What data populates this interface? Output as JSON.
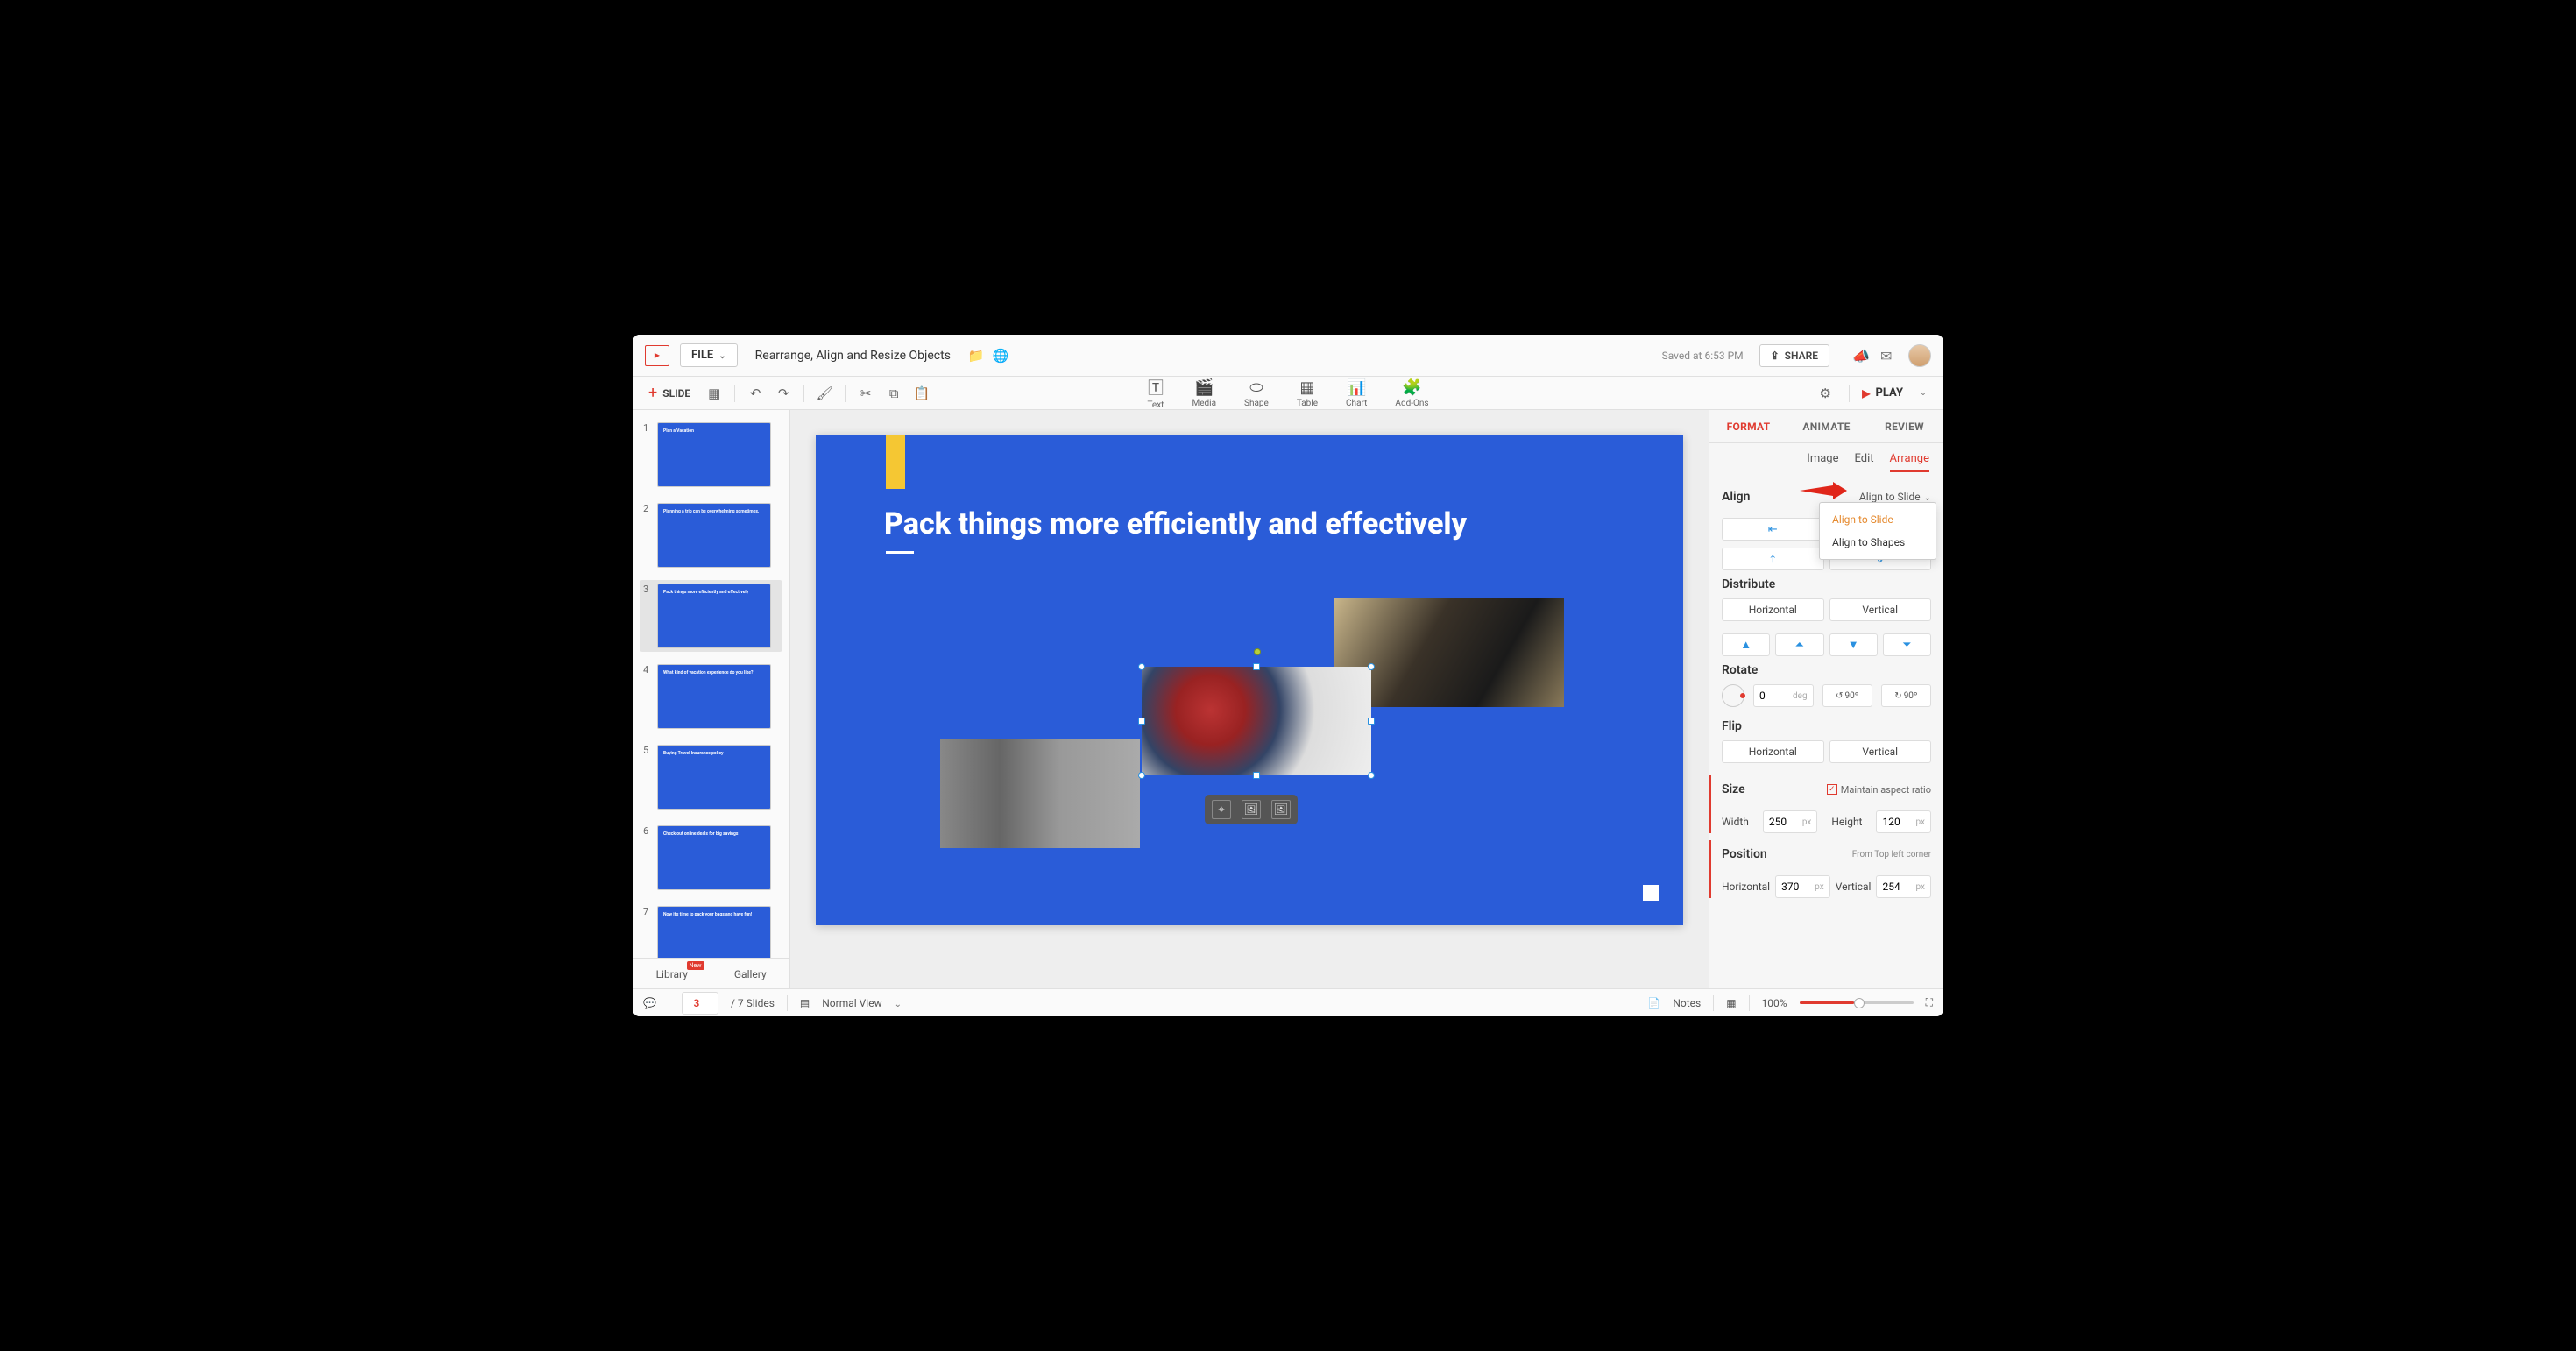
{
  "top": {
    "file_label": "FILE",
    "doc_title": "Rearrange, Align and Resize Objects",
    "saved_text": "Saved at 6:53 PM",
    "share_label": "SHARE"
  },
  "ribbon": {
    "add_slide": "SLIDE",
    "tools": {
      "text": "Text",
      "media": "Media",
      "shape": "Shape",
      "table": "Table",
      "chart": "Chart",
      "addons": "Add-Ons"
    },
    "play": "PLAY"
  },
  "thumbs": {
    "items": [
      {
        "n": "1",
        "title": "Plan a Vacation"
      },
      {
        "n": "2",
        "title": "Planning a trip can be overwhelming sometimes."
      },
      {
        "n": "3",
        "title": "Pack things more efficiently and effectively"
      },
      {
        "n": "4",
        "title": "What kind of vacation experience do you like?"
      },
      {
        "n": "5",
        "title": "Buying Travel Insurance policy"
      },
      {
        "n": "6",
        "title": "Check out online deals for big savings"
      },
      {
        "n": "7",
        "title": "Now it's time to pack your bags and have fun!"
      }
    ],
    "tabs": {
      "library": "Library",
      "gallery": "Gallery",
      "badge": "New"
    }
  },
  "slide": {
    "headline": "Pack things more efficiently and effectively"
  },
  "panel": {
    "tabs": {
      "format": "FORMAT",
      "animate": "ANIMATE",
      "review": "REVIEW"
    },
    "subtabs": {
      "image": "Image",
      "edit": "Edit",
      "arrange": "Arrange"
    },
    "align": {
      "title": "Align",
      "dropdown_label": "Align to Slide",
      "opt_slide": "Align to Slide",
      "opt_shapes": "Align to Shapes"
    },
    "distribute": {
      "title": "Distribute",
      "horizontal": "Horizontal",
      "vertical": "Vertical"
    },
    "rotate": {
      "title": "Rotate",
      "value": "0",
      "unit": "deg",
      "step": "90º"
    },
    "flip": {
      "title": "Flip",
      "horizontal": "Horizontal",
      "vertical": "Vertical"
    },
    "size": {
      "title": "Size",
      "aspect": "Maintain aspect ratio",
      "width_label": "Width",
      "width_val": "250",
      "height_label": "Height",
      "height_val": "120",
      "unit": "px"
    },
    "position": {
      "title": "Position",
      "note": "From Top left corner",
      "h_label": "Horizontal",
      "h_val": "370",
      "v_label": "Vertical",
      "v_val": "254",
      "unit": "px"
    }
  },
  "status": {
    "current": "3",
    "total_label": "/ 7 Slides",
    "view": "Normal View",
    "notes": "Notes",
    "zoom": "100%"
  }
}
